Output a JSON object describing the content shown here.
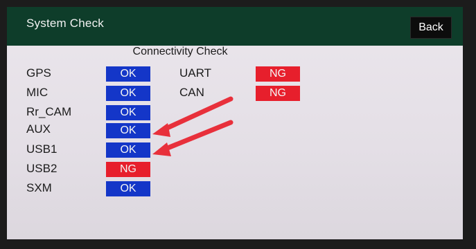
{
  "header": {
    "title": "System Check",
    "back_label": "Back"
  },
  "section": {
    "title": "Connectivity Check"
  },
  "left_items": [
    {
      "label": "GPS",
      "status": "OK"
    },
    {
      "label": "MIC",
      "status": "OK"
    },
    {
      "label": "Rr_CAM",
      "status": "OK"
    },
    {
      "label": "AUX",
      "status": "OK"
    },
    {
      "label": "USB1",
      "status": "OK"
    },
    {
      "label": "USB2",
      "status": "NG"
    },
    {
      "label": "SXM",
      "status": "OK"
    }
  ],
  "right_items": [
    {
      "label": "UART",
      "status": "NG"
    },
    {
      "label": "CAN",
      "status": "NG"
    }
  ],
  "colors": {
    "ok": "#1436c8",
    "ng": "#e71f2c",
    "header": "#0e3d2a",
    "annotation_arrow": "#e8303b"
  }
}
